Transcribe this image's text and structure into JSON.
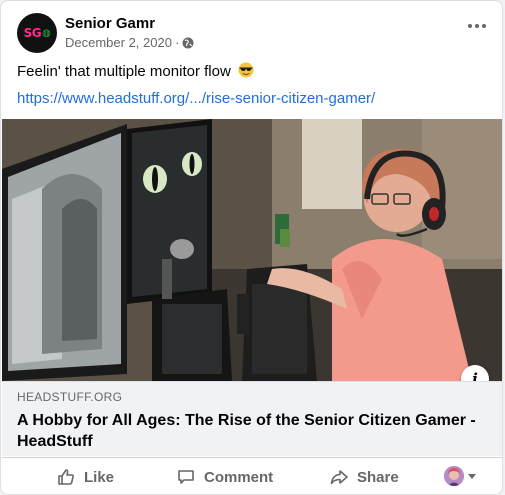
{
  "post": {
    "page_name": "Senior Gamr",
    "date": "December 2, 2020",
    "separator": "·",
    "avatar_text": "SG",
    "avatar_glyph": "🎮",
    "text": "Feelin' that multiple monitor flow",
    "link": "https://www.headstuff.org/.../rise-senior-citizen-gamer/",
    "privacy_icon": "globe-icon",
    "emoji": "sunglasses-emoji"
  },
  "link_preview": {
    "domain": "HEADSTUFF.ORG",
    "title": "A Hobby for All Ages: The Rise of the Senior Citizen Gamer - HeadStuff",
    "info_label": "i"
  },
  "actions": {
    "like": "Like",
    "comment": "Comment",
    "share": "Share"
  },
  "colors": {
    "link": "#216fdb",
    "meta": "#65676b",
    "avatar_bg": "#111111",
    "avatar_accent": "#ff2d8a"
  }
}
